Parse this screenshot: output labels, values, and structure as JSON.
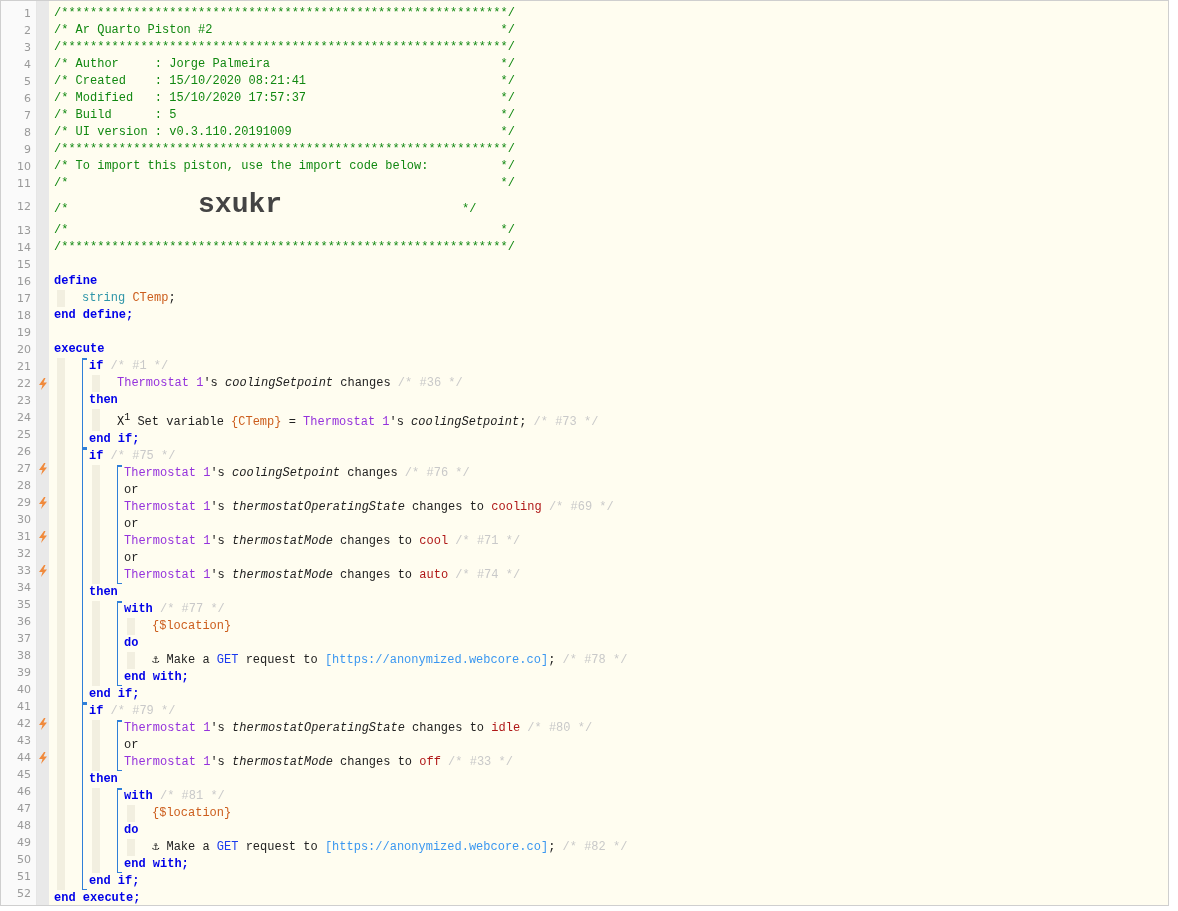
{
  "code": [
    {
      "kind": "line",
      "n": "1",
      "trigger": false,
      "tokens": [
        {
          "kind": "comment",
          "text": "/**************************************************************/"
        }
      ]
    },
    {
      "kind": "line",
      "n": "2",
      "trigger": false,
      "tokens": [
        {
          "kind": "comment",
          "text": "/* Ar Quarto Piston #2                                        */"
        }
      ]
    },
    {
      "kind": "line",
      "n": "3",
      "trigger": false,
      "tokens": [
        {
          "kind": "comment",
          "text": "/**************************************************************/"
        }
      ]
    },
    {
      "kind": "line",
      "n": "4",
      "trigger": false,
      "tokens": [
        {
          "kind": "comment",
          "text": "/* Author     : Jorge Palmeira                                */"
        }
      ]
    },
    {
      "kind": "line",
      "n": "5",
      "trigger": false,
      "tokens": [
        {
          "kind": "comment",
          "text": "/* Created    : 15/10/2020 08:21:41                           */"
        }
      ]
    },
    {
      "kind": "line",
      "n": "6",
      "trigger": false,
      "tokens": [
        {
          "kind": "comment",
          "text": "/* Modified   : 15/10/2020 17:57:37                           */"
        }
      ]
    },
    {
      "kind": "line",
      "n": "7",
      "trigger": false,
      "tokens": [
        {
          "kind": "comment",
          "text": "/* Build      : 5                                             */"
        }
      ]
    },
    {
      "kind": "line",
      "n": "8",
      "trigger": false,
      "tokens": [
        {
          "kind": "comment",
          "text": "/* UI version : v0.3.110.20191009                             */"
        }
      ]
    },
    {
      "kind": "line",
      "n": "9",
      "trigger": false,
      "tokens": [
        {
          "kind": "comment",
          "text": "/**************************************************************/"
        }
      ]
    },
    {
      "kind": "line",
      "n": "10",
      "trigger": false,
      "tokens": [
        {
          "kind": "comment",
          "text": "/* To import this piston, use the import code below:          */"
        }
      ]
    },
    {
      "kind": "line",
      "n": "11",
      "trigger": false,
      "tokens": [
        {
          "kind": "comment",
          "text": "/*                                                            */"
        }
      ]
    },
    {
      "kind": "line",
      "n": "12",
      "trigger": false,
      "tokens": [
        {
          "kind": "comment",
          "text": "/*                  "
        },
        {
          "kind": "import",
          "text": "sxukr"
        },
        {
          "kind": "comment",
          "text": "                         */"
        }
      ]
    },
    {
      "kind": "line",
      "n": "13",
      "trigger": false,
      "tokens": [
        {
          "kind": "comment",
          "text": "/*                                                            */"
        }
      ]
    },
    {
      "kind": "line",
      "n": "14",
      "trigger": false,
      "tokens": [
        {
          "kind": "comment",
          "text": "/**************************************************************/"
        }
      ]
    },
    {
      "kind": "line",
      "n": "15",
      "trigger": false
    },
    {
      "kind": "line",
      "n": "16",
      "trigger": false,
      "tokens": [
        {
          "kind": "kw",
          "text": "define"
        }
      ],
      "children": [
        {
          "kind": "line",
          "n": "17",
          "trigger": false,
          "tokens": [
            {
              "kind": "type",
              "text": "string "
            },
            {
              "kind": "var",
              "text": "CTemp"
            },
            {
              "kind": "text",
              "text": ";"
            }
          ]
        }
      ]
    },
    {
      "kind": "line",
      "n": "18",
      "trigger": false,
      "tokens": [
        {
          "kind": "kw",
          "text": "end define;"
        }
      ]
    },
    {
      "kind": "line",
      "n": "19",
      "trigger": false
    },
    {
      "kind": "line",
      "n": "20",
      "trigger": false,
      "tokens": [
        {
          "kind": "kw",
          "text": "execute"
        }
      ],
      "children": [
        {
          "kind": "bracket",
          "children": [
            {
              "kind": "line",
              "n": "21",
              "trigger": false,
              "tokens": [
                {
                  "kind": "kw",
                  "text": "if"
                },
                {
                  "kind": "note",
                  "text": " /* #1 */"
                }
              ],
              "children": [
                {
                  "kind": "line",
                  "n": "22",
                  "trigger": true,
                  "tokens": [
                    {
                      "kind": "device",
                      "text": "Thermostat 1"
                    },
                    {
                      "kind": "text",
                      "text": "'s "
                    },
                    {
                      "kind": "attr",
                      "text": "coolingSetpoint"
                    },
                    {
                      "kind": "text",
                      "text": " changes"
                    },
                    {
                      "kind": "note",
                      "text": " /* #36 */"
                    }
                  ]
                }
              ]
            },
            {
              "kind": "line",
              "n": "23",
              "trigger": false,
              "tokens": [
                {
                  "kind": "kw",
                  "text": "then"
                }
              ],
              "children": [
                {
                  "kind": "line",
                  "n": "24",
                  "trigger": false,
                  "tokens": [
                    {
                      "kind": "symbol",
                      "text": "X$^{1}$"
                    },
                    {
                      "kind": "text",
                      "text": " Set variable "
                    },
                    {
                      "kind": "var",
                      "text": "{CTemp}"
                    },
                    {
                      "kind": "text",
                      "text": " = "
                    },
                    {
                      "kind": "device",
                      "text": "Thermostat 1"
                    },
                    {
                      "kind": "text",
                      "text": "'s "
                    },
                    {
                      "kind": "attr",
                      "text": "coolingSetpoint"
                    },
                    {
                      "kind": "text",
                      "text": ";"
                    },
                    {
                      "kind": "note",
                      "text": " /* #73 */"
                    }
                  ]
                }
              ]
            },
            {
              "kind": "line",
              "n": "25",
              "trigger": false,
              "tokens": [
                {
                  "kind": "kw",
                  "text": "end if;"
                }
              ]
            }
          ]
        },
        {
          "kind": "bracket",
          "children": [
            {
              "kind": "line",
              "n": "26",
              "trigger": false,
              "tokens": [
                {
                  "kind": "kw",
                  "text": "if"
                },
                {
                  "kind": "note",
                  "text": " /* #75 */"
                }
              ],
              "children": [
                {
                  "kind": "bracket",
                  "children": [
                    {
                      "kind": "line",
                      "n": "27",
                      "trigger": true,
                      "tokens": [
                        {
                          "kind": "device",
                          "text": "Thermostat 1"
                        },
                        {
                          "kind": "text",
                          "text": "'s "
                        },
                        {
                          "kind": "attr",
                          "text": "coolingSetpoint"
                        },
                        {
                          "kind": "text",
                          "text": " changes"
                        },
                        {
                          "kind": "note",
                          "text": " /* #76 */"
                        }
                      ]
                    },
                    {
                      "kind": "line",
                      "n": "28",
                      "trigger": false,
                      "tokens": [
                        {
                          "kind": "text",
                          "text": "or"
                        }
                      ]
                    },
                    {
                      "kind": "line",
                      "n": "29",
                      "trigger": true,
                      "tokens": [
                        {
                          "kind": "device",
                          "text": "Thermostat 1"
                        },
                        {
                          "kind": "text",
                          "text": "'s "
                        },
                        {
                          "kind": "attr",
                          "text": "thermostatOperatingState"
                        },
                        {
                          "kind": "text",
                          "text": " changes to "
                        },
                        {
                          "kind": "value",
                          "text": "cooling"
                        },
                        {
                          "kind": "note",
                          "text": " /* #69 */"
                        }
                      ]
                    },
                    {
                      "kind": "line",
                      "n": "30",
                      "trigger": false,
                      "tokens": [
                        {
                          "kind": "text",
                          "text": "or"
                        }
                      ]
                    },
                    {
                      "kind": "line",
                      "n": "31",
                      "trigger": true,
                      "tokens": [
                        {
                          "kind": "device",
                          "text": "Thermostat 1"
                        },
                        {
                          "kind": "text",
                          "text": "'s "
                        },
                        {
                          "kind": "attr",
                          "text": "thermostatMode"
                        },
                        {
                          "kind": "text",
                          "text": " changes to "
                        },
                        {
                          "kind": "value",
                          "text": "cool"
                        },
                        {
                          "kind": "note",
                          "text": " /* #71 */"
                        }
                      ]
                    },
                    {
                      "kind": "line",
                      "n": "32",
                      "trigger": false,
                      "tokens": [
                        {
                          "kind": "text",
                          "text": "or"
                        }
                      ]
                    },
                    {
                      "kind": "line",
                      "n": "33",
                      "trigger": true,
                      "tokens": [
                        {
                          "kind": "device",
                          "text": "Thermostat 1"
                        },
                        {
                          "kind": "text",
                          "text": "'s "
                        },
                        {
                          "kind": "attr",
                          "text": "thermostatMode"
                        },
                        {
                          "kind": "text",
                          "text": " changes to "
                        },
                        {
                          "kind": "value",
                          "text": "auto"
                        },
                        {
                          "kind": "note",
                          "text": " /* #74 */"
                        }
                      ]
                    }
                  ]
                }
              ]
            },
            {
              "kind": "line",
              "n": "34",
              "trigger": false,
              "tokens": [
                {
                  "kind": "kw",
                  "text": "then"
                }
              ],
              "children": [
                {
                  "kind": "bracket",
                  "children": [
                    {
                      "kind": "line",
                      "n": "35",
                      "trigger": false,
                      "tokens": [
                        {
                          "kind": "kw",
                          "text": "with"
                        },
                        {
                          "kind": "note",
                          "text": " /* #77 */"
                        }
                      ],
                      "children": [
                        {
                          "kind": "line",
                          "n": "36",
                          "trigger": false,
                          "tokens": [
                            {
                              "kind": "var",
                              "text": "{$location}"
                            }
                          ]
                        }
                      ]
                    },
                    {
                      "kind": "line",
                      "n": "37",
                      "trigger": false,
                      "tokens": [
                        {
                          "kind": "kw",
                          "text": "do"
                        }
                      ],
                      "children": [
                        {
                          "kind": "line",
                          "n": "38",
                          "trigger": false,
                          "tokens": [
                            {
                              "kind": "symbol",
                              "text": "⚓"
                            },
                            {
                              "kind": "text",
                              "text": " Make a "
                            },
                            {
                              "kind": "kwn",
                              "text": "GET"
                            },
                            {
                              "kind": "text",
                              "text": " request to "
                            },
                            {
                              "kind": "url",
                              "text": "[https://anonymized.webcore.co]"
                            },
                            {
                              "kind": "text",
                              "text": ";"
                            },
                            {
                              "kind": "note",
                              "text": " /* #78 */"
                            }
                          ]
                        }
                      ]
                    },
                    {
                      "kind": "line",
                      "n": "39",
                      "trigger": false,
                      "tokens": [
                        {
                          "kind": "kw",
                          "text": "end with;"
                        }
                      ]
                    }
                  ]
                }
              ]
            },
            {
              "kind": "line",
              "n": "40",
              "trigger": false,
              "tokens": [
                {
                  "kind": "kw",
                  "text": "end if;"
                }
              ]
            }
          ]
        },
        {
          "kind": "bracket",
          "children": [
            {
              "kind": "line",
              "n": "41",
              "trigger": false,
              "tokens": [
                {
                  "kind": "kw",
                  "text": "if"
                },
                {
                  "kind": "note",
                  "text": " /* #79 */"
                }
              ],
              "children": [
                {
                  "kind": "bracket",
                  "children": [
                    {
                      "kind": "line",
                      "n": "42",
                      "trigger": true,
                      "tokens": [
                        {
                          "kind": "device",
                          "text": "Thermostat 1"
                        },
                        {
                          "kind": "text",
                          "text": "'s "
                        },
                        {
                          "kind": "attr",
                          "text": "thermostatOperatingState"
                        },
                        {
                          "kind": "text",
                          "text": " changes to "
                        },
                        {
                          "kind": "value",
                          "text": "idle"
                        },
                        {
                          "kind": "note",
                          "text": " /* #80 */"
                        }
                      ]
                    },
                    {
                      "kind": "line",
                      "n": "43",
                      "trigger": false,
                      "tokens": [
                        {
                          "kind": "text",
                          "text": "or"
                        }
                      ]
                    },
                    {
                      "kind": "line",
                      "n": "44",
                      "trigger": true,
                      "tokens": [
                        {
                          "kind": "device",
                          "text": "Thermostat 1"
                        },
                        {
                          "kind": "text",
                          "text": "'s "
                        },
                        {
                          "kind": "attr",
                          "text": "thermostatMode"
                        },
                        {
                          "kind": "text",
                          "text": " changes to "
                        },
                        {
                          "kind": "value",
                          "text": "off"
                        },
                        {
                          "kind": "note",
                          "text": " /* #33 */"
                        }
                      ]
                    }
                  ]
                }
              ]
            },
            {
              "kind": "line",
              "n": "45",
              "trigger": false,
              "tokens": [
                {
                  "kind": "kw",
                  "text": "then"
                }
              ],
              "children": [
                {
                  "kind": "bracket",
                  "children": [
                    {
                      "kind": "line",
                      "n": "46",
                      "trigger": false,
                      "tokens": [
                        {
                          "kind": "kw",
                          "text": "with"
                        },
                        {
                          "kind": "note",
                          "text": " /* #81 */"
                        }
                      ],
                      "children": [
                        {
                          "kind": "line",
                          "n": "47",
                          "trigger": false,
                          "tokens": [
                            {
                              "kind": "var",
                              "text": "{$location}"
                            }
                          ]
                        }
                      ]
                    },
                    {
                      "kind": "line",
                      "n": "48",
                      "trigger": false,
                      "tokens": [
                        {
                          "kind": "kw",
                          "text": "do"
                        }
                      ],
                      "children": [
                        {
                          "kind": "line",
                          "n": "49",
                          "trigger": false,
                          "tokens": [
                            {
                              "kind": "symbol",
                              "text": "⚓"
                            },
                            {
                              "kind": "text",
                              "text": " Make a "
                            },
                            {
                              "kind": "kwn",
                              "text": "GET"
                            },
                            {
                              "kind": "text",
                              "text": " request to "
                            },
                            {
                              "kind": "url",
                              "text": "[https://anonymized.webcore.co]"
                            },
                            {
                              "kind": "text",
                              "text": ";"
                            },
                            {
                              "kind": "note",
                              "text": " /* #82 */"
                            }
                          ]
                        }
                      ]
                    },
                    {
                      "kind": "line",
                      "n": "50",
                      "trigger": false,
                      "tokens": [
                        {
                          "kind": "kw",
                          "text": "end with;"
                        }
                      ]
                    }
                  ]
                }
              ]
            },
            {
              "kind": "line",
              "n": "51",
              "trigger": false,
              "tokens": [
                {
                  "kind": "kw",
                  "text": "end if;"
                }
              ]
            }
          ]
        }
      ]
    },
    {
      "kind": "line",
      "n": "52",
      "trigger": false,
      "tokens": [
        {
          "kind": "kw",
          "text": "end execute;"
        }
      ]
    }
  ]
}
